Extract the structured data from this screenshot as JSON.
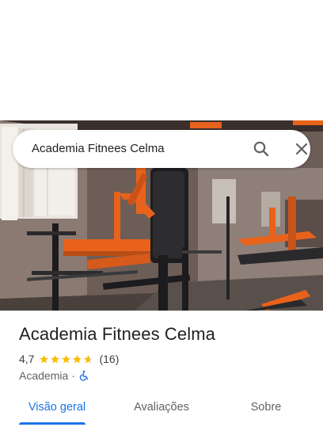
{
  "search": {
    "query": "Academia Fitnees Celma"
  },
  "place": {
    "title": "Academia Fitnees Celma",
    "rating": "4,7",
    "stars": 4.7,
    "review_count": "(16)",
    "category": "Academia",
    "separator": "·",
    "accessibility_icon": "wheelchair-icon"
  },
  "tabs": [
    {
      "label": "Visão geral",
      "active": true
    },
    {
      "label": "Avaliações",
      "active": false
    },
    {
      "label": "Sobre",
      "active": false
    }
  ],
  "colors": {
    "accent": "#1a73e8",
    "star": "#fbbc04",
    "equipment_orange": "#e8621c"
  }
}
